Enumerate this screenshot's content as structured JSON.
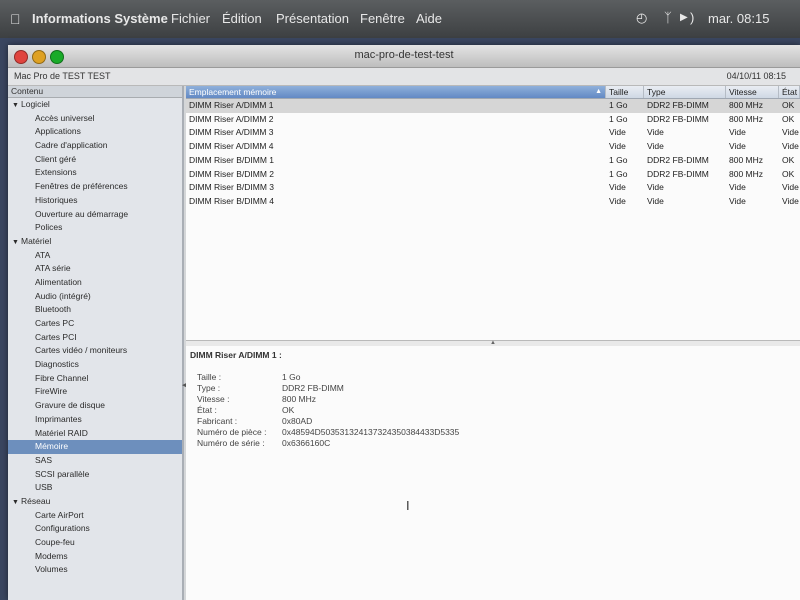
{
  "menubar": {
    "apple_icon": "apple-icon",
    "app_name": "Informations Système",
    "menus": [
      "Fichier",
      "Édition",
      "Présentation",
      "Fenêtre",
      "Aide"
    ],
    "status_icons": [
      "time-machine-icon",
      "bluetooth-icon",
      "play-icon",
      "volume-icon"
    ],
    "clock": "mar. 08:15"
  },
  "window": {
    "title": "mac-pro-de-test-test",
    "machine_name": "Mac Pro de TEST TEST",
    "date": "04/10/11 08:15"
  },
  "sidebar": {
    "header": "Contenu",
    "items": [
      {
        "label": "Logiciel",
        "type": "group"
      },
      {
        "label": "Accès universel",
        "type": "child"
      },
      {
        "label": "Applications",
        "type": "child"
      },
      {
        "label": "Cadre d'application",
        "type": "child"
      },
      {
        "label": "Client géré",
        "type": "child"
      },
      {
        "label": "Extensions",
        "type": "child"
      },
      {
        "label": "Fenêtres de préférences",
        "type": "child"
      },
      {
        "label": "Historiques",
        "type": "child"
      },
      {
        "label": "Ouverture au démarrage",
        "type": "child"
      },
      {
        "label": "Polices",
        "type": "child"
      },
      {
        "label": "Matériel",
        "type": "group"
      },
      {
        "label": "ATA",
        "type": "child"
      },
      {
        "label": "ATA série",
        "type": "child"
      },
      {
        "label": "Alimentation",
        "type": "child"
      },
      {
        "label": "Audio (intégré)",
        "type": "child"
      },
      {
        "label": "Bluetooth",
        "type": "child"
      },
      {
        "label": "Cartes PC",
        "type": "child"
      },
      {
        "label": "Cartes PCI",
        "type": "child"
      },
      {
        "label": "Cartes vidéo / moniteurs",
        "type": "child"
      },
      {
        "label": "Diagnostics",
        "type": "child"
      },
      {
        "label": "Fibre Channel",
        "type": "child"
      },
      {
        "label": "FireWire",
        "type": "child"
      },
      {
        "label": "Gravure de disque",
        "type": "child"
      },
      {
        "label": "Imprimantes",
        "type": "child"
      },
      {
        "label": "Matériel RAID",
        "type": "child"
      },
      {
        "label": "Mémoire",
        "type": "child",
        "selected": true
      },
      {
        "label": "SAS",
        "type": "child"
      },
      {
        "label": "SCSI parallèle",
        "type": "child"
      },
      {
        "label": "USB",
        "type": "child"
      },
      {
        "label": "Réseau",
        "type": "group"
      },
      {
        "label": "Carte AirPort",
        "type": "child"
      },
      {
        "label": "Configurations",
        "type": "child"
      },
      {
        "label": "Coupe-feu",
        "type": "child"
      },
      {
        "label": "Modems",
        "type": "child"
      },
      {
        "label": "Volumes",
        "type": "child"
      }
    ]
  },
  "memory_table": {
    "columns": [
      "Emplacement mémoire",
      "Taille",
      "Type",
      "Vitesse",
      "État"
    ],
    "rows": [
      {
        "slot": "DIMM Riser A/DIMM 1",
        "size": "1 Go",
        "type": "DDR2 FB-DIMM",
        "speed": "800 MHz",
        "status": "OK"
      },
      {
        "slot": "DIMM Riser A/DIMM 2",
        "size": "1 Go",
        "type": "DDR2 FB-DIMM",
        "speed": "800 MHz",
        "status": "OK"
      },
      {
        "slot": "DIMM Riser A/DIMM 3",
        "size": "Vide",
        "type": "Vide",
        "speed": "Vide",
        "status": "Vide"
      },
      {
        "slot": "DIMM Riser A/DIMM 4",
        "size": "Vide",
        "type": "Vide",
        "speed": "Vide",
        "status": "Vide"
      },
      {
        "slot": "DIMM Riser B/DIMM 1",
        "size": "1 Go",
        "type": "DDR2 FB-DIMM",
        "speed": "800 MHz",
        "status": "OK"
      },
      {
        "slot": "DIMM Riser B/DIMM 2",
        "size": "1 Go",
        "type": "DDR2 FB-DIMM",
        "speed": "800 MHz",
        "status": "OK"
      },
      {
        "slot": "DIMM Riser B/DIMM 3",
        "size": "Vide",
        "type": "Vide",
        "speed": "Vide",
        "status": "Vide"
      },
      {
        "slot": "DIMM Riser B/DIMM 4",
        "size": "Vide",
        "type": "Vide",
        "speed": "Vide",
        "status": "Vide"
      }
    ]
  },
  "detail": {
    "title": "DIMM Riser A/DIMM 1 :",
    "fields": [
      {
        "label": "Taille :",
        "value": "1 Go"
      },
      {
        "label": "Type :",
        "value": "DDR2 FB-DIMM"
      },
      {
        "label": "Vitesse :",
        "value": "800 MHz"
      },
      {
        "label": "État :",
        "value": "OK"
      },
      {
        "label": "Fabricant :",
        "value": "0x80AD"
      },
      {
        "label": "Numéro de pièce :",
        "value": "0x48594D503531324137324350384433D5335"
      },
      {
        "label": "Numéro de série :",
        "value": "0x6366160C"
      }
    ]
  },
  "colors": {
    "selection": "#6d8fbd",
    "header_sorted": "#6289c4"
  }
}
